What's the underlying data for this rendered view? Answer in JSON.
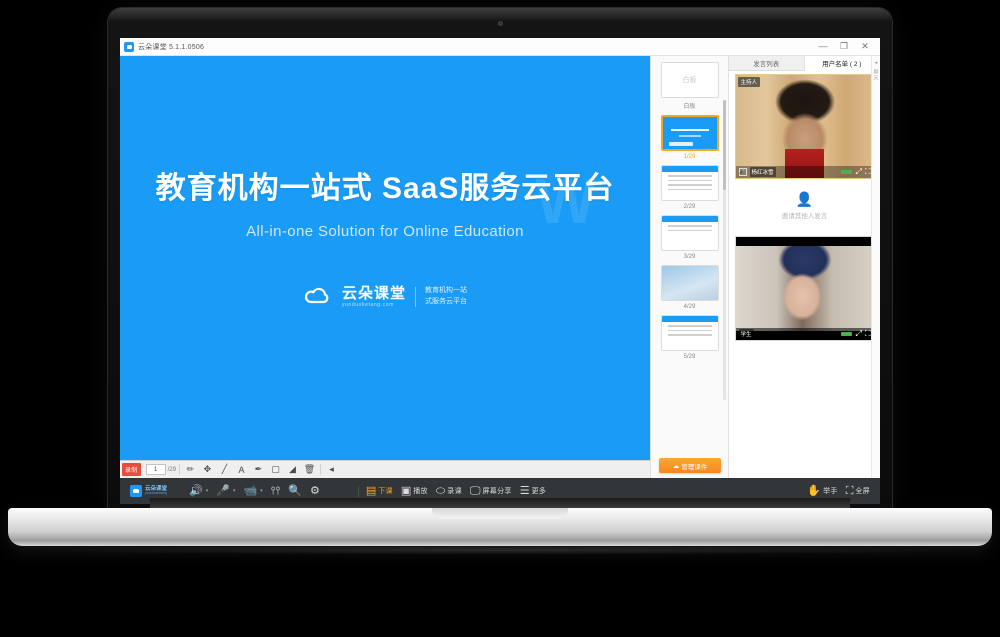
{
  "window": {
    "title": "云朵课堂 5.1.1.0506",
    "minimize": "—",
    "maximize": "❐",
    "close": "✕"
  },
  "slide": {
    "title": "教育机构一站式  SaaS服务云平台",
    "subtitle": "All-in-one Solution for Online Education",
    "watermark": "W",
    "logo_cn": "云朵课堂",
    "logo_en": "yunduoketang.com",
    "tagline_line1": "教育机构一站",
    "tagline_line2": "式服务云平台"
  },
  "whiteboard_tools": {
    "record_label": "录制",
    "page_current": "1",
    "page_total": "/29",
    "tools": [
      {
        "name": "pen-tool",
        "glyph": "✏"
      },
      {
        "name": "move-tool",
        "glyph": "✥"
      },
      {
        "name": "line-tool",
        "glyph": "╱"
      },
      {
        "name": "text-tool",
        "glyph": "A"
      },
      {
        "name": "marker-tool",
        "glyph": "✒"
      },
      {
        "name": "rect-tool",
        "glyph": "▢"
      },
      {
        "name": "eraser-tool",
        "glyph": "◢"
      },
      {
        "name": "delete-tool",
        "glyph": "🗑"
      },
      {
        "name": "collapse-tool",
        "glyph": "◂"
      }
    ]
  },
  "thumbnails": {
    "whiteboard_label": "白板",
    "whiteboard_icon_text": "白板",
    "items": [
      {
        "label": "1/29",
        "kind": "slide-blue",
        "active": true
      },
      {
        "label": "2/29",
        "kind": "doc",
        "active": false
      },
      {
        "label": "3/29",
        "kind": "doc",
        "active": false
      },
      {
        "label": "4/29",
        "kind": "image",
        "active": false
      },
      {
        "label": "5/29",
        "kind": "doc",
        "active": false
      }
    ],
    "manage_button": "管理课件",
    "manage_icon": "☁"
  },
  "right_panel": {
    "tabs": [
      {
        "label": "发言列表",
        "active": false
      },
      {
        "label": "用户名单 ( 2 )",
        "active": true
      }
    ],
    "video_top": {
      "corner_tag": "主持人",
      "name": "杨红冰雪",
      "mic_icon": "🎤",
      "video_icon": "📹",
      "expand_icon": "⤢",
      "fullscreen_icon": "⛶"
    },
    "invite": {
      "icon": "👤",
      "text": "邀请其他人发言"
    },
    "video_bottom": {
      "name": "学生",
      "expand_icon": "⤢",
      "fullscreen_icon": "⛶"
    },
    "rail_arrow": "◂",
    "rail_text": "聊天"
  },
  "dock": {
    "brand_cn": "云朵课堂",
    "brand_en": "yunduoketang",
    "left_items": [
      {
        "name": "speaker-button",
        "glyph": "🔊",
        "label": "",
        "caret": "▾"
      },
      {
        "name": "microphone-button",
        "glyph": "🎤",
        "label": "",
        "caret": "▾",
        "color": "orange"
      },
      {
        "name": "camera-button",
        "glyph": "📹",
        "label": "",
        "caret": "▾",
        "color": "orange"
      },
      {
        "name": "equalizer-button",
        "glyph": "⫯⫯",
        "label": "",
        "caret": ""
      },
      {
        "name": "zoom-button",
        "glyph": "🔍",
        "label": "",
        "caret": ""
      },
      {
        "name": "settings-button",
        "glyph": "⚙",
        "label": "",
        "caret": ""
      }
    ],
    "center_items": [
      {
        "name": "class-button",
        "glyph": "▤",
        "label": "下课",
        "active": true
      },
      {
        "name": "playback-button",
        "glyph": "▣",
        "label": "播放",
        "active": false
      },
      {
        "name": "record-button",
        "glyph": "⬭",
        "label": "录课",
        "active": false
      },
      {
        "name": "screenshare-button",
        "glyph": "🖵",
        "label": "屏幕分享",
        "active": false
      },
      {
        "name": "more-button",
        "glyph": "☰",
        "label": "更多",
        "active": false
      }
    ],
    "right_items": [
      {
        "name": "raise-hand-button",
        "glyph": "✋",
        "label": "举手"
      },
      {
        "name": "fullscreen-button",
        "glyph": "⛶",
        "label": "全屏"
      }
    ]
  }
}
